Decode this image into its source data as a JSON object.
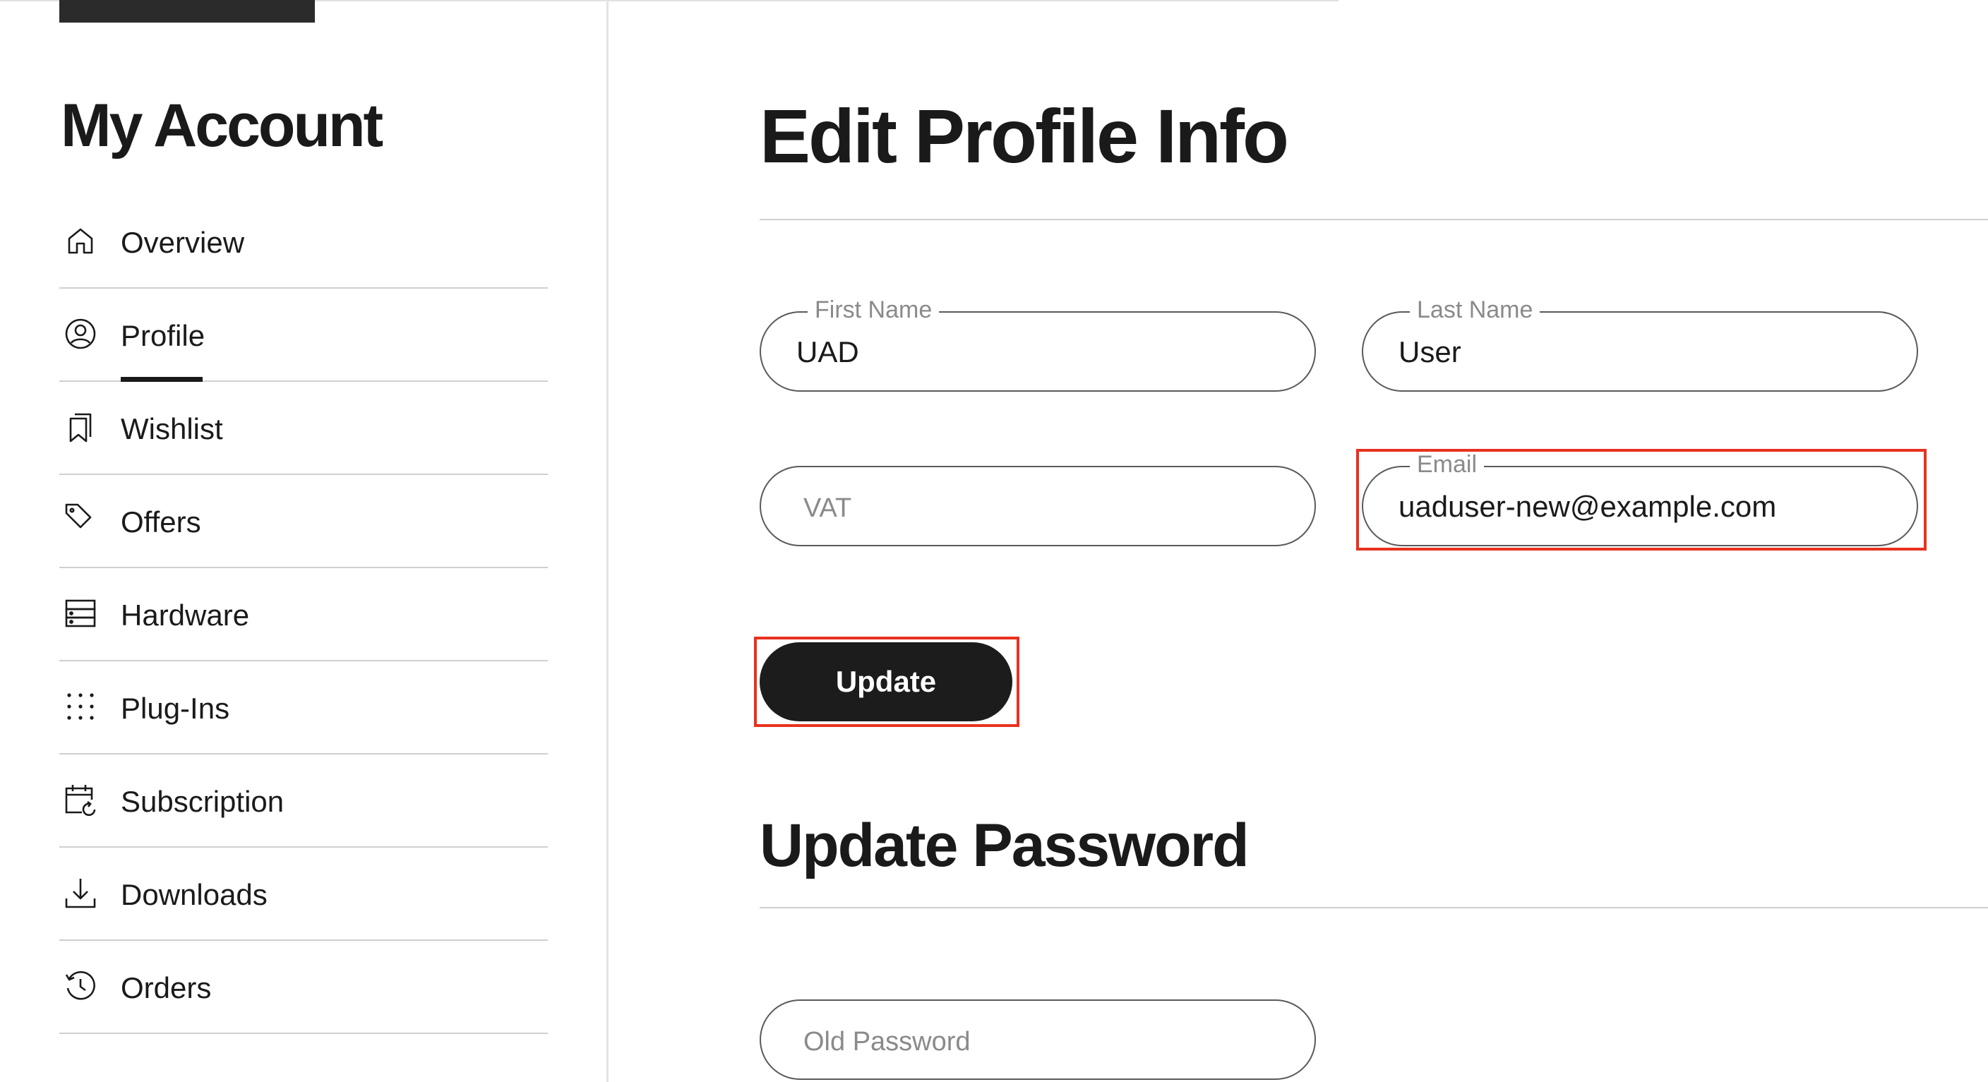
{
  "sidebar": {
    "title": "My Account",
    "items": [
      {
        "label": "Overview",
        "icon": "home-icon",
        "active": false
      },
      {
        "label": "Profile",
        "icon": "user-circle-icon",
        "active": true
      },
      {
        "label": "Wishlist",
        "icon": "bookmark-icon",
        "active": false
      },
      {
        "label": "Offers",
        "icon": "tag-icon",
        "active": false
      },
      {
        "label": "Hardware",
        "icon": "server-icon",
        "active": false
      },
      {
        "label": "Plug-Ins",
        "icon": "dots-grid-icon",
        "active": false
      },
      {
        "label": "Subscription",
        "icon": "calendar-refresh-icon",
        "active": false
      },
      {
        "label": "Downloads",
        "icon": "download-icon",
        "active": false
      },
      {
        "label": "Orders",
        "icon": "history-icon",
        "active": false
      }
    ]
  },
  "profile": {
    "title": "Edit Profile Info",
    "first_name": {
      "label": "First Name",
      "value": "UAD"
    },
    "last_name": {
      "label": "Last Name",
      "value": "User"
    },
    "vat": {
      "placeholder": "VAT",
      "value": ""
    },
    "email": {
      "label": "Email",
      "value": "uaduser-new@example.com"
    },
    "update_label": "Update"
  },
  "password": {
    "title": "Update Password",
    "old_password": {
      "placeholder": "Old Password",
      "value": ""
    }
  },
  "colors": {
    "accent": "#1c1c1c",
    "highlight": "#e8311f",
    "border": "#5a5a5a"
  }
}
